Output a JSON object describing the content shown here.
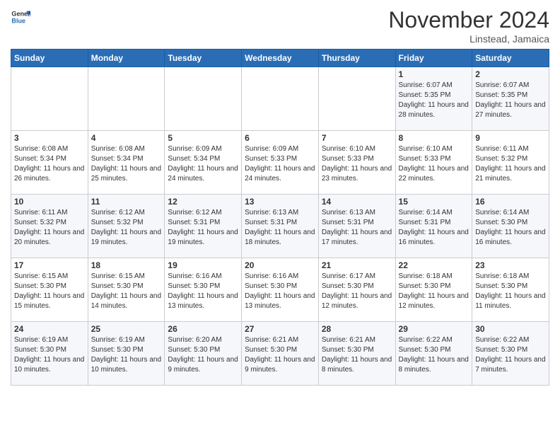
{
  "header": {
    "logo_line1": "General",
    "logo_line2": "Blue",
    "month_title": "November 2024",
    "location": "Linstead, Jamaica"
  },
  "weekdays": [
    "Sunday",
    "Monday",
    "Tuesday",
    "Wednesday",
    "Thursday",
    "Friday",
    "Saturday"
  ],
  "weeks": [
    [
      {
        "day": "",
        "info": ""
      },
      {
        "day": "",
        "info": ""
      },
      {
        "day": "",
        "info": ""
      },
      {
        "day": "",
        "info": ""
      },
      {
        "day": "",
        "info": ""
      },
      {
        "day": "1",
        "info": "Sunrise: 6:07 AM\nSunset: 5:35 PM\nDaylight: 11 hours and 28 minutes."
      },
      {
        "day": "2",
        "info": "Sunrise: 6:07 AM\nSunset: 5:35 PM\nDaylight: 11 hours and 27 minutes."
      }
    ],
    [
      {
        "day": "3",
        "info": "Sunrise: 6:08 AM\nSunset: 5:34 PM\nDaylight: 11 hours and 26 minutes."
      },
      {
        "day": "4",
        "info": "Sunrise: 6:08 AM\nSunset: 5:34 PM\nDaylight: 11 hours and 25 minutes."
      },
      {
        "day": "5",
        "info": "Sunrise: 6:09 AM\nSunset: 5:34 PM\nDaylight: 11 hours and 24 minutes."
      },
      {
        "day": "6",
        "info": "Sunrise: 6:09 AM\nSunset: 5:33 PM\nDaylight: 11 hours and 24 minutes."
      },
      {
        "day": "7",
        "info": "Sunrise: 6:10 AM\nSunset: 5:33 PM\nDaylight: 11 hours and 23 minutes."
      },
      {
        "day": "8",
        "info": "Sunrise: 6:10 AM\nSunset: 5:33 PM\nDaylight: 11 hours and 22 minutes."
      },
      {
        "day": "9",
        "info": "Sunrise: 6:11 AM\nSunset: 5:32 PM\nDaylight: 11 hours and 21 minutes."
      }
    ],
    [
      {
        "day": "10",
        "info": "Sunrise: 6:11 AM\nSunset: 5:32 PM\nDaylight: 11 hours and 20 minutes."
      },
      {
        "day": "11",
        "info": "Sunrise: 6:12 AM\nSunset: 5:32 PM\nDaylight: 11 hours and 19 minutes."
      },
      {
        "day": "12",
        "info": "Sunrise: 6:12 AM\nSunset: 5:31 PM\nDaylight: 11 hours and 19 minutes."
      },
      {
        "day": "13",
        "info": "Sunrise: 6:13 AM\nSunset: 5:31 PM\nDaylight: 11 hours and 18 minutes."
      },
      {
        "day": "14",
        "info": "Sunrise: 6:13 AM\nSunset: 5:31 PM\nDaylight: 11 hours and 17 minutes."
      },
      {
        "day": "15",
        "info": "Sunrise: 6:14 AM\nSunset: 5:31 PM\nDaylight: 11 hours and 16 minutes."
      },
      {
        "day": "16",
        "info": "Sunrise: 6:14 AM\nSunset: 5:30 PM\nDaylight: 11 hours and 16 minutes."
      }
    ],
    [
      {
        "day": "17",
        "info": "Sunrise: 6:15 AM\nSunset: 5:30 PM\nDaylight: 11 hours and 15 minutes."
      },
      {
        "day": "18",
        "info": "Sunrise: 6:15 AM\nSunset: 5:30 PM\nDaylight: 11 hours and 14 minutes."
      },
      {
        "day": "19",
        "info": "Sunrise: 6:16 AM\nSunset: 5:30 PM\nDaylight: 11 hours and 13 minutes."
      },
      {
        "day": "20",
        "info": "Sunrise: 6:16 AM\nSunset: 5:30 PM\nDaylight: 11 hours and 13 minutes."
      },
      {
        "day": "21",
        "info": "Sunrise: 6:17 AM\nSunset: 5:30 PM\nDaylight: 11 hours and 12 minutes."
      },
      {
        "day": "22",
        "info": "Sunrise: 6:18 AM\nSunset: 5:30 PM\nDaylight: 11 hours and 12 minutes."
      },
      {
        "day": "23",
        "info": "Sunrise: 6:18 AM\nSunset: 5:30 PM\nDaylight: 11 hours and 11 minutes."
      }
    ],
    [
      {
        "day": "24",
        "info": "Sunrise: 6:19 AM\nSunset: 5:30 PM\nDaylight: 11 hours and 10 minutes."
      },
      {
        "day": "25",
        "info": "Sunrise: 6:19 AM\nSunset: 5:30 PM\nDaylight: 11 hours and 10 minutes."
      },
      {
        "day": "26",
        "info": "Sunrise: 6:20 AM\nSunset: 5:30 PM\nDaylight: 11 hours and 9 minutes."
      },
      {
        "day": "27",
        "info": "Sunrise: 6:21 AM\nSunset: 5:30 PM\nDaylight: 11 hours and 9 minutes."
      },
      {
        "day": "28",
        "info": "Sunrise: 6:21 AM\nSunset: 5:30 PM\nDaylight: 11 hours and 8 minutes."
      },
      {
        "day": "29",
        "info": "Sunrise: 6:22 AM\nSunset: 5:30 PM\nDaylight: 11 hours and 8 minutes."
      },
      {
        "day": "30",
        "info": "Sunrise: 6:22 AM\nSunset: 5:30 PM\nDaylight: 11 hours and 7 minutes."
      }
    ]
  ]
}
